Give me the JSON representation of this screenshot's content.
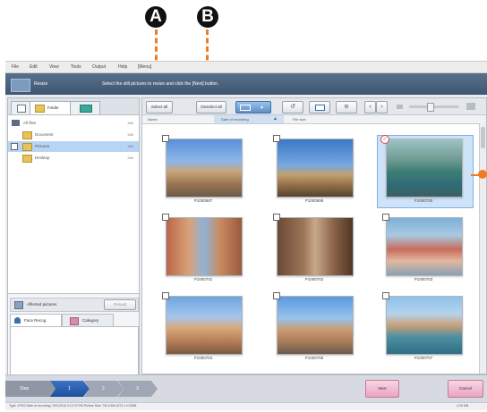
{
  "callouts": {
    "a": "A",
    "b": "B"
  },
  "menu": [
    "File",
    "Edit",
    "View",
    "Tools",
    "Output",
    "Help",
    "[Menu]"
  ],
  "title": {
    "app_name": "Resize",
    "instruction": "Select the still pictures to resize and click the [Next] button."
  },
  "left_tabs": {
    "folder": "Folder"
  },
  "tree": [
    {
      "label": "All files",
      "count": "345"
    },
    {
      "label": "Document",
      "count": "345"
    },
    {
      "label": "Pictures",
      "count": "345"
    },
    {
      "label": "Desktop",
      "count": "345"
    }
  ],
  "left_bottom": {
    "affected_pictures": "Affected pictures",
    "reload": "Reload",
    "face_recog": "Face Recog.",
    "category": "Category"
  },
  "toolbar": {
    "select_all": "Select all",
    "deselect_all": "Deselect all"
  },
  "sortbar": {
    "name": "Name",
    "date": "Date of recording",
    "file_size": "File size"
  },
  "photos": [
    {
      "name": "P1000697"
    },
    {
      "name": "P1000698"
    },
    {
      "name": "P1000700"
    },
    {
      "name": "P1000701"
    },
    {
      "name": "P1000702"
    },
    {
      "name": "P1000703"
    },
    {
      "name": "P1000704"
    },
    {
      "name": "P1000705"
    },
    {
      "name": "P1000707"
    }
  ],
  "footer": {
    "step": "Step",
    "steps": [
      "1",
      "2",
      "3"
    ],
    "next": "Next",
    "cancel": "Cancel"
  },
  "status": {
    "info": "Type: JPEG  Date of recording: 3/31/2010 2:12:22 PM  Picture Size: TW 6.6M  4272 x H 2848",
    "size": "4.30 MB"
  },
  "colors": {
    "accent_orange": "#f07c22",
    "pink_button": "#f2b8cf",
    "selection": "#b8d4f5"
  }
}
